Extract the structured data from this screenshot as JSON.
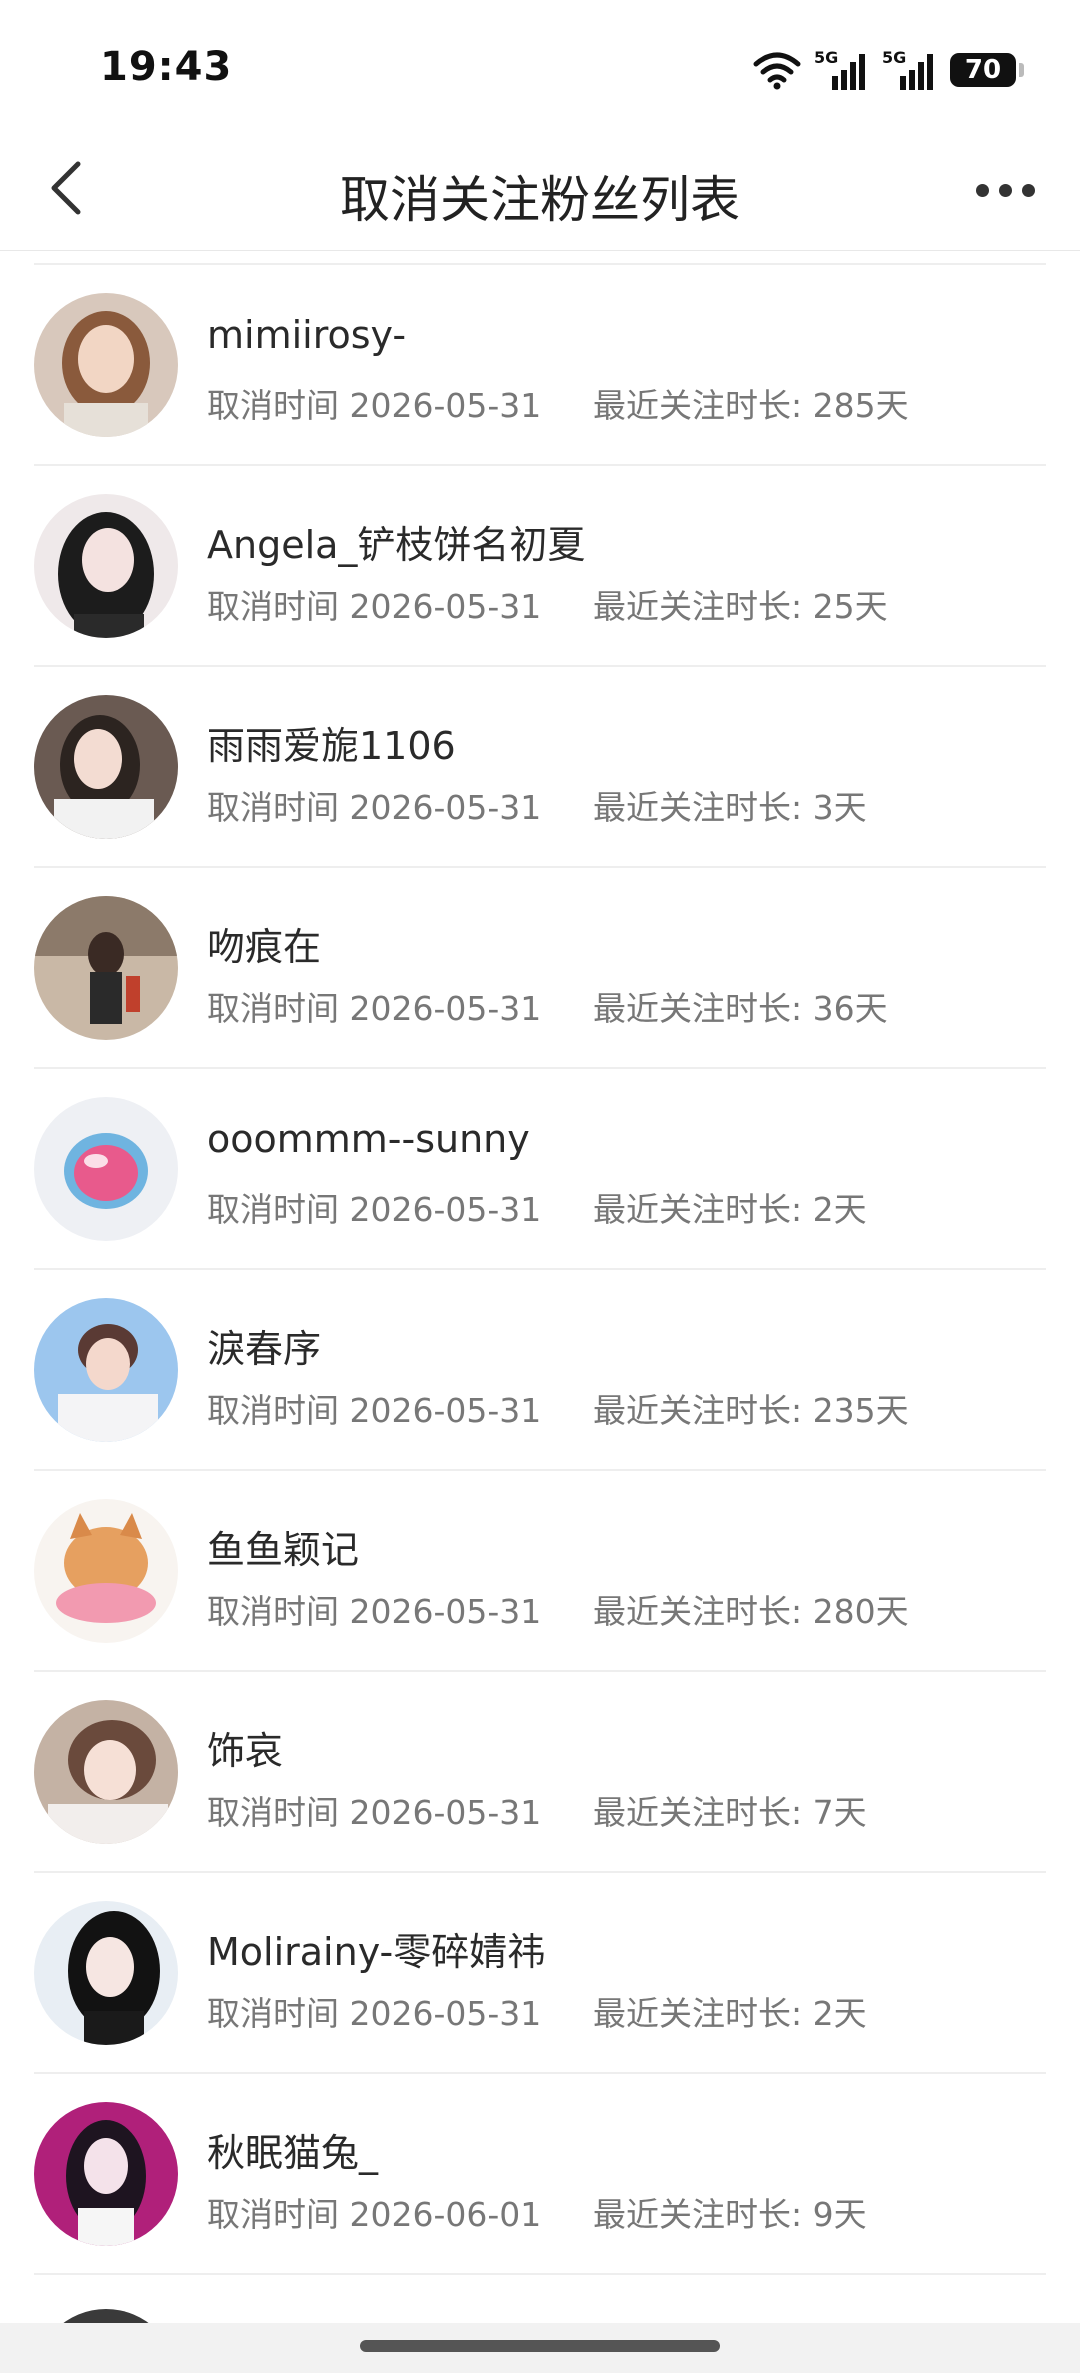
{
  "status_bar": {
    "time": "19:43",
    "net1": "5G",
    "net2": "5G",
    "battery": "70"
  },
  "nav": {
    "title": "取消关注粉丝列表",
    "back_icon": "chevron-left-icon",
    "more_icon": "more-dots-icon"
  },
  "items": [
    {
      "name": "mimiirosy-",
      "cancel_time": "取消时间 2026-05-31",
      "duration": "最近关注时长: 285天"
    },
    {
      "name": "Angela_铲枝饼名初夏",
      "cancel_time": "取消时间 2026-05-31",
      "duration": "最近关注时长: 25天"
    },
    {
      "name": "雨雨爱旎1106",
      "cancel_time": "取消时间 2026-05-31",
      "duration": "最近关注时长: 3天"
    },
    {
      "name": "吻痕在",
      "cancel_time": "取消时间 2026-05-31",
      "duration": "最近关注时长: 36天"
    },
    {
      "name": "ooommm--sunny",
      "cancel_time": "取消时间 2026-05-31",
      "duration": "最近关注时长: 2天"
    },
    {
      "name": "淚春序",
      "cancel_time": "取消时间 2026-05-31",
      "duration": "最近关注时长: 235天"
    },
    {
      "name": "鱼鱼颖记",
      "cancel_time": "取消时间 2026-05-31",
      "duration": "最近关注时长: 280天"
    },
    {
      "name": "饰哀",
      "cancel_time": "取消时间 2026-05-31",
      "duration": "最近关注时长: 7天"
    },
    {
      "name": "Molirainy-零碎婧祎",
      "cancel_time": "取消时间 2026-05-31",
      "duration": "最近关注时长: 2天"
    },
    {
      "name": "秋眠猫兔_",
      "cancel_time": "取消时间 2026-06-01",
      "duration": "最近关注时长: 9天"
    }
  ]
}
